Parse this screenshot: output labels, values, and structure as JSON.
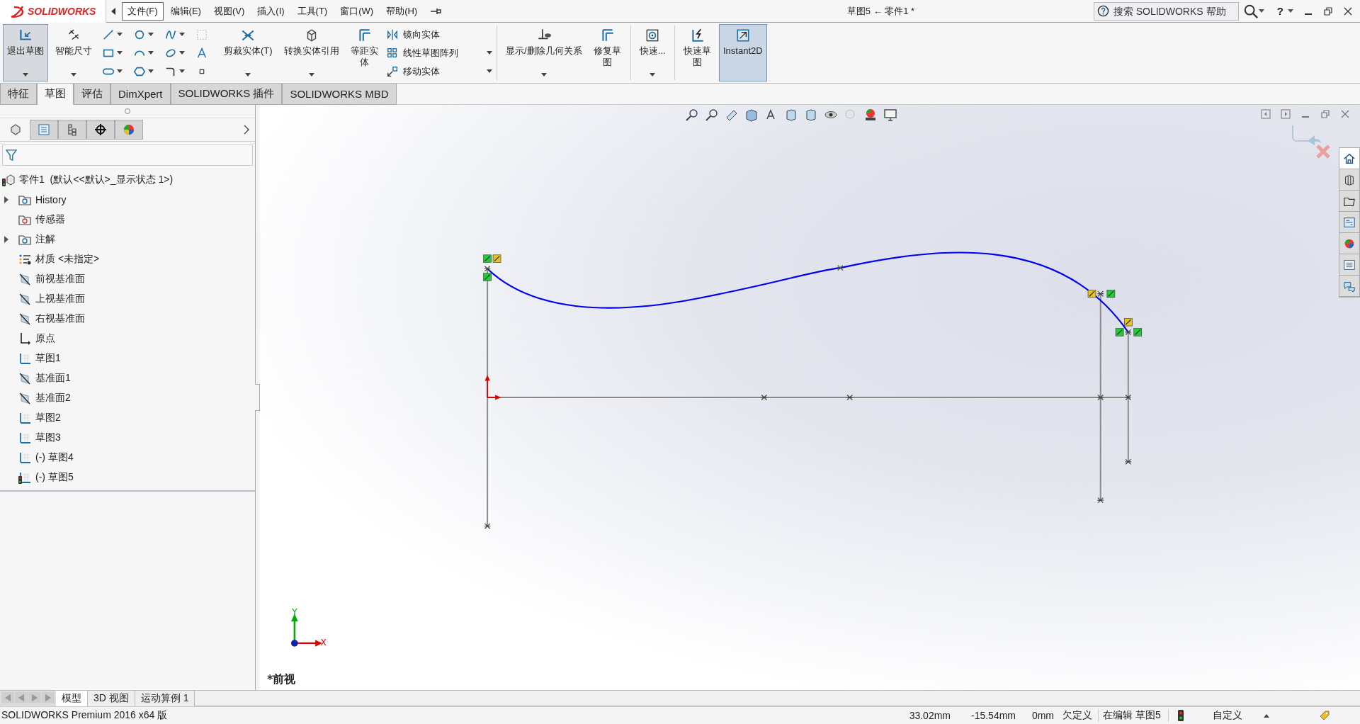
{
  "app_logo": "SOLIDWORKS",
  "menus": [
    {
      "label": "文件(F)",
      "selected": true
    },
    {
      "label": "编辑(E)",
      "selected": false
    },
    {
      "label": "视图(V)",
      "selected": false
    },
    {
      "label": "插入(I)",
      "selected": false
    },
    {
      "label": "工具(T)",
      "selected": false
    },
    {
      "label": "窗口(W)",
      "selected": false
    },
    {
      "label": "帮助(H)",
      "selected": false
    }
  ],
  "window": {
    "title": "草图5 ← 零件1 *"
  },
  "search": {
    "placeholder": "搜索 SOLIDWORKS 帮助"
  },
  "help_glyph": "?",
  "ribbon": [
    {
      "kind": "large",
      "label": "退出草图",
      "selected": true,
      "dropdown": true
    },
    {
      "kind": "large",
      "label": "智能尺寸",
      "selected": false,
      "dropdown": true
    },
    {
      "kind": "tool_grid"
    },
    {
      "kind": "large",
      "label": "剪裁实体(T)",
      "selected": false,
      "dropdown": true
    },
    {
      "kind": "large",
      "label": "转换实体引用",
      "selected": false,
      "dropdown": true
    },
    {
      "kind": "large",
      "label": "等距实体",
      "selected": false,
      "dropdown": false
    },
    {
      "kind": "stack",
      "items": [
        {
          "label": "镜向实体",
          "dropdown": false
        },
        {
          "label": "线性草图阵列",
          "dropdown": true
        },
        {
          "label": "移动实体",
          "dropdown": true
        }
      ]
    },
    {
      "kind": "separator"
    },
    {
      "kind": "large",
      "label": "显示/删除几何关系",
      "selected": false,
      "dropdown": true
    },
    {
      "kind": "large",
      "label": "修复草图",
      "selected": false,
      "dropdown": false
    },
    {
      "kind": "separator"
    },
    {
      "kind": "large",
      "label": "快速...",
      "selected": false,
      "dropdown": true
    },
    {
      "kind": "separator"
    },
    {
      "kind": "large",
      "label": "快速草图",
      "selected": false,
      "dropdown": false
    },
    {
      "kind": "large",
      "label": "Instant2D",
      "selected": true,
      "dropdown": false
    }
  ],
  "command_tabs": [
    {
      "label": "特征",
      "selected": false
    },
    {
      "label": "草图",
      "selected": true
    },
    {
      "label": "评估",
      "selected": false
    },
    {
      "label": "DimXpert",
      "selected": false
    },
    {
      "label": "SOLIDWORKS 插件",
      "selected": false
    },
    {
      "label": "SOLIDWORKS MBD",
      "selected": false
    }
  ],
  "panel_tabs": [
    {
      "selected": true
    },
    {
      "selected": false
    },
    {
      "selected": false
    },
    {
      "selected": false
    },
    {
      "selected": false
    }
  ],
  "tree": {
    "root": "零件1  (默认<<默认>_显示状态 1>)",
    "items": [
      {
        "label": "History",
        "kind": "history",
        "expandable": true
      },
      {
        "label": "传感器",
        "kind": "sensor",
        "expandable": false
      },
      {
        "label": "注解",
        "kind": "annotation",
        "expandable": true
      },
      {
        "label": "材质 <未指定>",
        "kind": "material",
        "expandable": false
      },
      {
        "label": "前视基准面",
        "kind": "plane",
        "expandable": false
      },
      {
        "label": "上视基准面",
        "kind": "plane",
        "expandable": false
      },
      {
        "label": "右视基准面",
        "kind": "plane",
        "expandable": false
      },
      {
        "label": "原点",
        "kind": "origin",
        "expandable": false
      },
      {
        "label": "草图1",
        "kind": "sketch",
        "expandable": false
      },
      {
        "label": "基准面1",
        "kind": "plane",
        "expandable": false
      },
      {
        "label": "基准面2",
        "kind": "plane",
        "expandable": false
      },
      {
        "label": "草图2",
        "kind": "sketch",
        "expandable": false
      },
      {
        "label": "草图3",
        "kind": "sketch",
        "expandable": false
      },
      {
        "label": "(-) 草图4",
        "kind": "sketch",
        "expandable": false
      },
      {
        "label": "(-) 草图5",
        "kind": "sketch_active",
        "expandable": false
      }
    ]
  },
  "viewport": {
    "view_label": "*前视",
    "triad": {
      "x": "X",
      "y": "Y"
    }
  },
  "bottom_tabs": [
    {
      "label": "模型",
      "selected": true
    },
    {
      "label": "3D 视图",
      "selected": false
    },
    {
      "label": "运动算例 1",
      "selected": false
    }
  ],
  "status_bar": {
    "product": "SOLIDWORKS Premium 2016 x64 版",
    "x": "33.02mm",
    "y": "-15.54mm",
    "z": "0mm",
    "state": "欠定义",
    "editing": "在编辑 草图5",
    "units": "自定义"
  }
}
